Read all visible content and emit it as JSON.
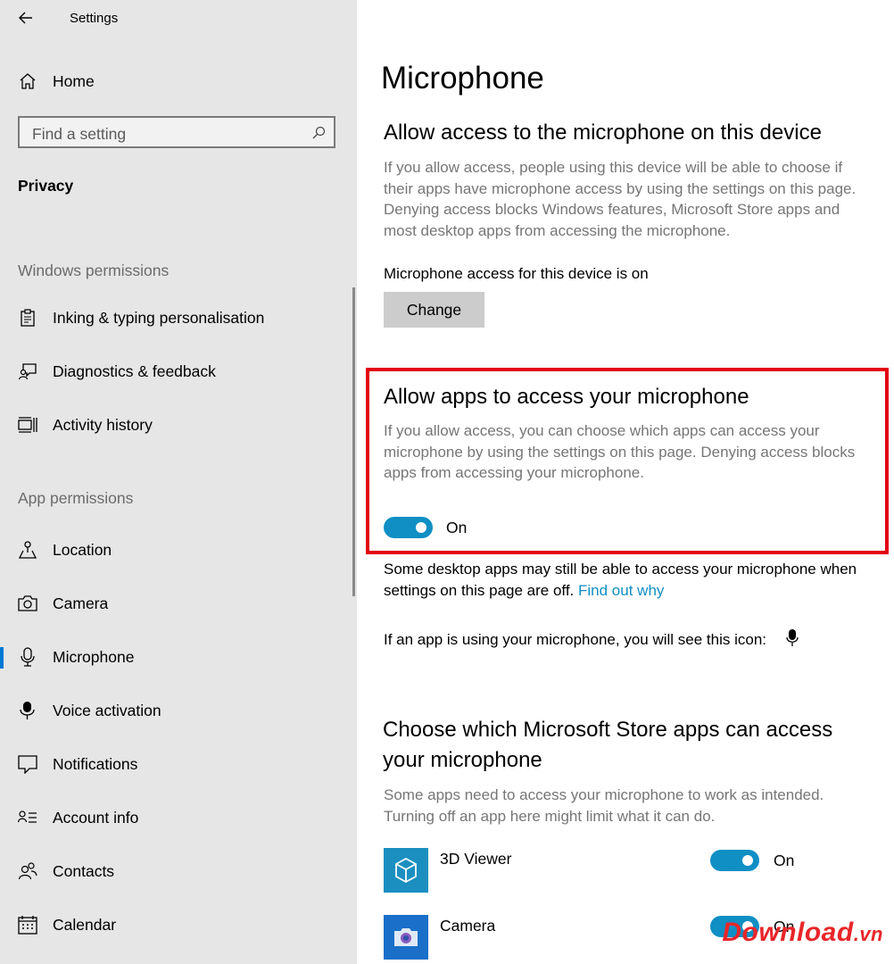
{
  "window": {
    "title": "Settings"
  },
  "sidebar": {
    "home_label": "Home",
    "search_placeholder": "Find a setting",
    "section_title": "Privacy",
    "windows_permissions_title": "Windows permissions",
    "windows_permissions": [
      {
        "label": "Inking & typing personalisation",
        "icon": "clipboard-icon"
      },
      {
        "label": "Diagnostics & feedback",
        "icon": "feedback-icon"
      },
      {
        "label": "Activity history",
        "icon": "activity-icon"
      }
    ],
    "app_permissions_title": "App permissions",
    "app_permissions": [
      {
        "label": "Location",
        "icon": "location-icon"
      },
      {
        "label": "Camera",
        "icon": "camera-icon"
      },
      {
        "label": "Microphone",
        "icon": "microphone-icon",
        "active": true
      },
      {
        "label": "Voice activation",
        "icon": "voice-activation-icon"
      },
      {
        "label": "Notifications",
        "icon": "notifications-icon"
      },
      {
        "label": "Account info",
        "icon": "account-info-icon"
      },
      {
        "label": "Contacts",
        "icon": "contacts-icon"
      },
      {
        "label": "Calendar",
        "icon": "calendar-icon"
      }
    ]
  },
  "main": {
    "title": "Microphone",
    "device_section": {
      "heading": "Allow access to the microphone on this device",
      "description": "If you allow access, people using this device will be able to choose if their apps have microphone access by using the settings on this page. Denying access blocks Windows features, Microsoft Store apps and most desktop apps from accessing the microphone.",
      "status": "Microphone access for this device is on",
      "change_button": "Change"
    },
    "apps_section": {
      "heading": "Allow apps to access your microphone",
      "description": "If you allow access, you can choose which apps can access your microphone by using the settings on this page. Denying access blocks apps from accessing your microphone.",
      "toggle_label": "On",
      "toggle_on": true
    },
    "desktop_note": "Some desktop apps may still be able to access your microphone when settings on this page are off.",
    "find_out_why": "Find out why",
    "icon_note": "If an app is using your microphone, you will see this icon:",
    "store_section": {
      "heading_line1": "Choose which Microsoft Store apps can access",
      "heading_line2": "your microphone",
      "description": "Some apps need to access your microphone to work as intended. Turning off an app here might limit what it can do.",
      "apps": [
        {
          "name": "3D Viewer",
          "toggle_label": "On",
          "toggle_on": true,
          "icon": "3d-viewer-icon"
        },
        {
          "name": "Camera",
          "toggle_label": "On",
          "toggle_on": true,
          "icon": "camera-app-icon"
        }
      ]
    }
  },
  "watermark": {
    "brand": "Download",
    "tld": ".vn"
  },
  "colors": {
    "accent": "#0f8fc4",
    "highlight_border": "#e3000f",
    "sidebar_bg": "#e6e6e6"
  }
}
